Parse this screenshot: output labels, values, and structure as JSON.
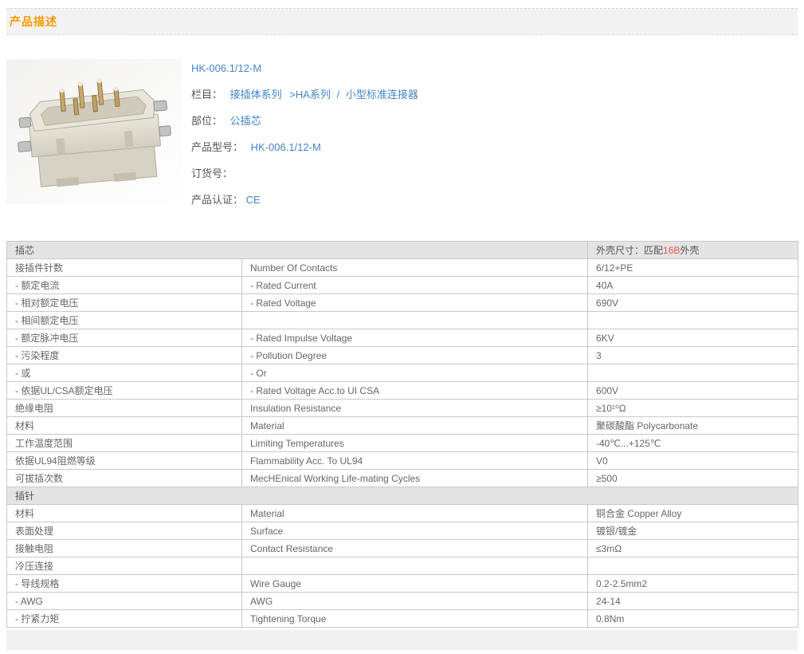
{
  "header": {
    "title": "产品描述"
  },
  "product": {
    "title": "HK-006.1/12-M",
    "image_alt": "connector-product-photo",
    "category": {
      "label": "栏目：",
      "links": [
        "接插体系列",
        ">HA系列",
        "小型标准连接器"
      ],
      "separator": "/"
    },
    "part": {
      "label": "部位：",
      "value": "公插芯"
    },
    "model": {
      "label": "产品型号：",
      "value": "HK-006.1/12-M"
    },
    "order": {
      "label": "订货号：",
      "value": ""
    },
    "cert": {
      "label": "产品认证：",
      "value": "CE"
    }
  },
  "colors": {
    "accent_orange": "#ff9900",
    "link_blue": "#4385c7",
    "highlight_red": "#f05050",
    "section_gray": "#e4e4e4"
  },
  "spec_table": {
    "sections": [
      {
        "header": {
          "left": "插芯",
          "right": [
            {
              "t": "外壳尺寸：匹配"
            },
            {
              "t": "16B",
              "red": true
            },
            {
              "t": "外壳"
            }
          ]
        },
        "rows": [
          {
            "cn": "接插件针数",
            "en": "Number Of Contacts",
            "value": "6/12+PE"
          },
          {
            "cn": "- 额定电流",
            "en": "- Rated Current",
            "value": "40A"
          },
          {
            "cn": "- 相对额定电压",
            "en": "- Rated Voltage",
            "value": "690V"
          },
          {
            "cn": "- 相间额定电压",
            "en": "",
            "value": ""
          },
          {
            "cn": "- 额定脉冲电压",
            "en": "- Rated Impulse Voltage",
            "value": "6KV"
          },
          {
            "cn": "- 污染程度",
            "en": "- Pollution Degree",
            "value": "3"
          },
          {
            "cn": "- 或",
            "en": "- Or",
            "value": ""
          },
          {
            "cn": "- 依据UL/CSA额定电压",
            "en": "- Rated Voltage Acc.to UI CSA",
            "value": "600V"
          },
          {
            "cn": "绝缘电阻",
            "en": "Insulation Resistance",
            "value": "≥10¹⁰Ω"
          },
          {
            "cn": "材料",
            "en": "Material",
            "value": "聚碳酸酯 Polycarbonate"
          },
          {
            "cn": "工作温度范围",
            "en": "Limiting Temperatures",
            "value": "-40℃...+125℃"
          },
          {
            "cn": "依据UL94阻燃等级",
            "en": "Flammability Acc. To UL94",
            "value": "V0"
          },
          {
            "cn": "可拔插次数",
            "en": "MecHEnical Working Life-mating Cycles",
            "value": "≥500"
          }
        ]
      },
      {
        "header": {
          "left": "插针"
        },
        "rows": [
          {
            "cn": "材料",
            "en": "Material",
            "value": "铜合金 Copper Alloy"
          },
          {
            "cn": "表面处理",
            "en": "Surface",
            "value": "镀银/镀金"
          },
          {
            "cn": "接触电阻",
            "en": "Contact Resistance",
            "value": "≤3mΩ"
          },
          {
            "cn": "冷压连接",
            "en": "",
            "value": ""
          },
          {
            "cn": "- 导线规格",
            "en": "Wire Gauge",
            "value": "0.2-2.5mm2"
          },
          {
            "cn": "- AWG",
            "en": "AWG",
            "value": "24-14"
          },
          {
            "cn": "- 拧紧力矩",
            "en": "Tightening Torque",
            "value": "0.8Nm"
          }
        ]
      }
    ]
  }
}
